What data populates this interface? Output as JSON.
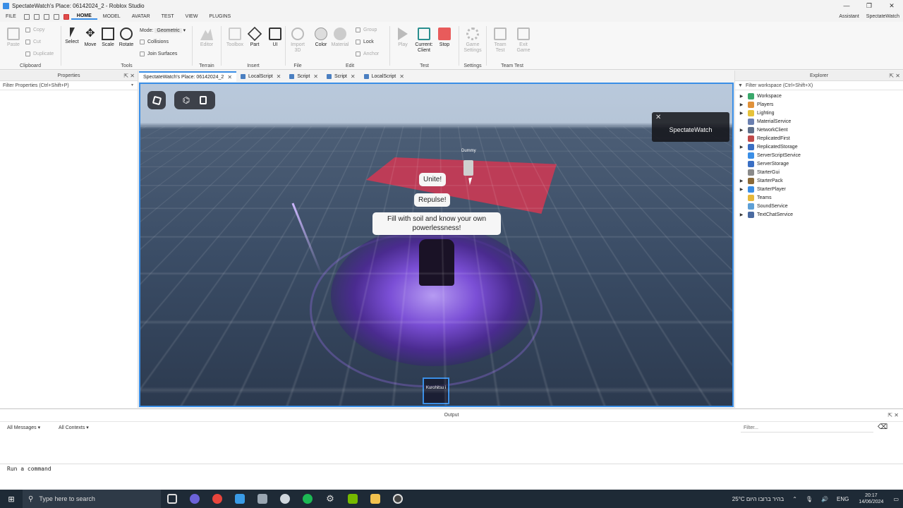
{
  "window": {
    "title": "SpectateWatch's Place: 06142024_2 - Roblox Studio",
    "controls": [
      "—",
      "❐",
      "✕"
    ]
  },
  "menu": {
    "items": [
      "FILE",
      "HOME",
      "MODEL",
      "AVATAR",
      "TEST",
      "VIEW",
      "PLUGINS"
    ],
    "right": {
      "assistant": "Assistant",
      "user": "SpectateWatch"
    }
  },
  "ribbon": {
    "clipboard": {
      "paste": "Paste",
      "copy": "Copy",
      "cut": "Cut",
      "duplicate": "Duplicate",
      "group_label": "Clipboard"
    },
    "tools": {
      "select": "Select",
      "move": "Move",
      "scale": "Scale",
      "rotate": "Rotate",
      "mode_label": "Mode:",
      "mode_value": "Geometric",
      "collisions": "Collisions",
      "join_surfaces": "Join Surfaces",
      "group_label": "Tools"
    },
    "terrain": {
      "editor": "Editor",
      "group_label": "Terrain"
    },
    "insert": {
      "toolbox": "Toolbox",
      "part": "Part",
      "ui": "UI",
      "group_label": "Insert"
    },
    "file": {
      "import3d": "Import 3D",
      "group_label": "File"
    },
    "edit": {
      "color": "Color",
      "material": "Material",
      "group": "Group",
      "lock": "Lock",
      "anchor": "Anchor",
      "group_label": "Edit"
    },
    "test": {
      "play": "Play",
      "current_client": "Current: Client",
      "stop": "Stop",
      "group_label": "Test"
    },
    "settings": {
      "game_settings": "Game Settings",
      "group_label": "Settings"
    },
    "team_test": {
      "team_test": "Team Test",
      "exit_game": "Exit Game",
      "group_label": "Team Test"
    }
  },
  "properties": {
    "title": "Properties",
    "filter": "Filter Properties (Ctrl+Shift+P)"
  },
  "tabs": [
    {
      "label": "SpectateWatch's Place: 06142024_2",
      "active": true
    },
    {
      "label": "LocalScript",
      "active": false
    },
    {
      "label": "Script",
      "active": false
    },
    {
      "label": "Script",
      "active": false
    },
    {
      "label": "LocalScript",
      "active": false
    }
  ],
  "viewport": {
    "spectate_label": "SpectateWatch",
    "dummy_name": "Dummy",
    "bubble_unite": "Unite!",
    "bubble_repulse": "Repulse!",
    "bubble_fill": "Fill with soil and know your own powerlessness!",
    "player_tag": "Kurohitsu i"
  },
  "explorer": {
    "title": "Explorer",
    "filter": "Filter workspace (Ctrl+Shift+X)",
    "items": [
      {
        "label": "Workspace",
        "expandable": true,
        "color": "#3aa86b"
      },
      {
        "label": "Players",
        "expandable": true,
        "color": "#e0913a"
      },
      {
        "label": "Lighting",
        "expandable": true,
        "color": "#e6c23a"
      },
      {
        "label": "MaterialService",
        "expandable": false,
        "color": "#6a7fb0"
      },
      {
        "label": "NetworkClient",
        "expandable": true,
        "color": "#5e6f8a"
      },
      {
        "label": "ReplicatedFirst",
        "expandable": false,
        "color": "#c04a4a"
      },
      {
        "label": "ReplicatedStorage",
        "expandable": true,
        "color": "#3a6fc4"
      },
      {
        "label": "ServerScriptService",
        "expandable": false,
        "color": "#3a8ee6"
      },
      {
        "label": "ServerStorage",
        "expandable": false,
        "color": "#3a6fc4"
      },
      {
        "label": "StarterGui",
        "expandable": false,
        "color": "#8a8a8a"
      },
      {
        "label": "StarterPack",
        "expandable": true,
        "color": "#8a6a3a"
      },
      {
        "label": "StarterPlayer",
        "expandable": true,
        "color": "#3a8ee6"
      },
      {
        "label": "Teams",
        "expandable": false,
        "color": "#e6b83a"
      },
      {
        "label": "SoundService",
        "expandable": false,
        "color": "#5ea0d6"
      },
      {
        "label": "TextChatService",
        "expandable": true,
        "color": "#4a6aa0"
      }
    ]
  },
  "output": {
    "title": "Output",
    "messages_filter": "All Messages",
    "contexts_filter": "All Contexts",
    "filter_placeholder": "Filter..."
  },
  "command": {
    "placeholder": "Run a command"
  },
  "taskbar": {
    "search": "Type here to search",
    "weather": "25°C  בהיר ברובו היום",
    "lang": "ENG",
    "time": "20:17",
    "date": "14/06/2024"
  }
}
